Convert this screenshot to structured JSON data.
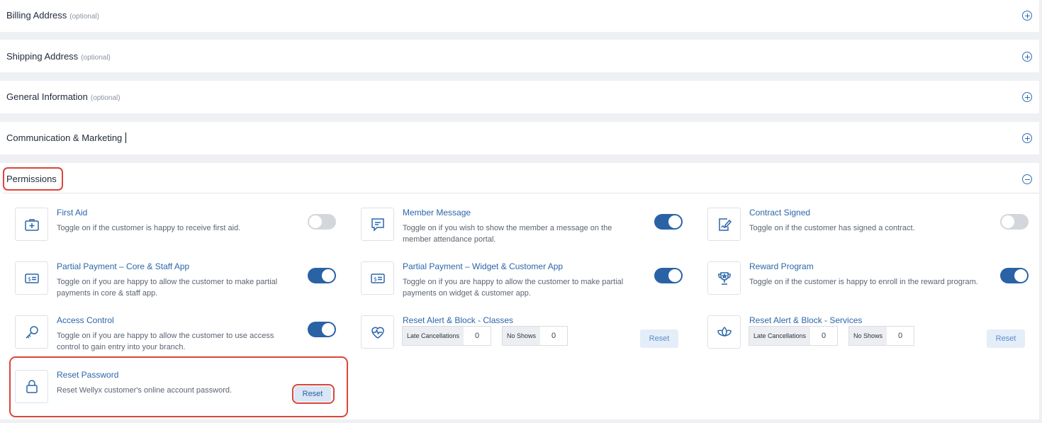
{
  "sections": {
    "billing": {
      "title": "Billing Address",
      "optional": "(optional)"
    },
    "shipping": {
      "title": "Shipping Address",
      "optional": "(optional)"
    },
    "general": {
      "title": "General Information",
      "optional": "(optional)"
    },
    "communication": {
      "title": "Communication & Marketing"
    },
    "permissions": {
      "title": "Permissions"
    }
  },
  "permissions": {
    "first_aid": {
      "title": "First Aid",
      "desc": "Toggle on if the customer is happy to receive first aid.",
      "enabled": false,
      "icon": "first-aid-icon"
    },
    "member_message": {
      "title": "Member Message",
      "desc": "Toggle on if you wish to show the member a message on the member attendance portal.",
      "enabled": true,
      "icon": "chat-icon"
    },
    "contract_signed": {
      "title": "Contract Signed",
      "desc": "Toggle on if the customer has signed a contract.",
      "enabled": false,
      "icon": "signature-icon"
    },
    "partial_core": {
      "title": "Partial Payment – Core & Staff App",
      "desc": "Toggle on if you are happy to allow the customer to make partial payments in core & staff app.",
      "enabled": true,
      "icon": "dollar-card-icon"
    },
    "partial_widget": {
      "title": "Partial Payment – Widget & Customer App",
      "desc": "Toggle on if you are happy to allow the customer to make partial payments on widget & customer app.",
      "enabled": true,
      "icon": "dollar-card-icon"
    },
    "reward": {
      "title": "Reward Program",
      "desc": "Toggle on if the customer is happy to enroll in the reward program.",
      "enabled": true,
      "icon": "trophy-icon"
    },
    "access": {
      "title": "Access Control",
      "desc": "Toggle on if you are happy to allow the customer to use access control to gain entry into your branch.",
      "enabled": true,
      "icon": "key-icon"
    },
    "reset_classes": {
      "title": "Reset Alert & Block - Classes",
      "late_label": "Late Cancellations",
      "late_value": "0",
      "noshow_label": "No Shows",
      "noshow_value": "0",
      "reset_label": "Reset",
      "icon": "heartbeat-icon"
    },
    "reset_services": {
      "title": "Reset Alert & Block - Services",
      "late_label": "Late Cancellations",
      "late_value": "0",
      "noshow_label": "No Shows",
      "noshow_value": "0",
      "reset_label": "Reset",
      "icon": "lotus-icon"
    },
    "reset_password": {
      "title": "Reset Password",
      "desc": "Reset Wellyx customer's online account password.",
      "reset_label": "Reset",
      "icon": "lock-icon"
    }
  },
  "colors": {
    "accent": "#2a62a6",
    "highlight": "#d9463a",
    "link": "#2c66a8"
  }
}
